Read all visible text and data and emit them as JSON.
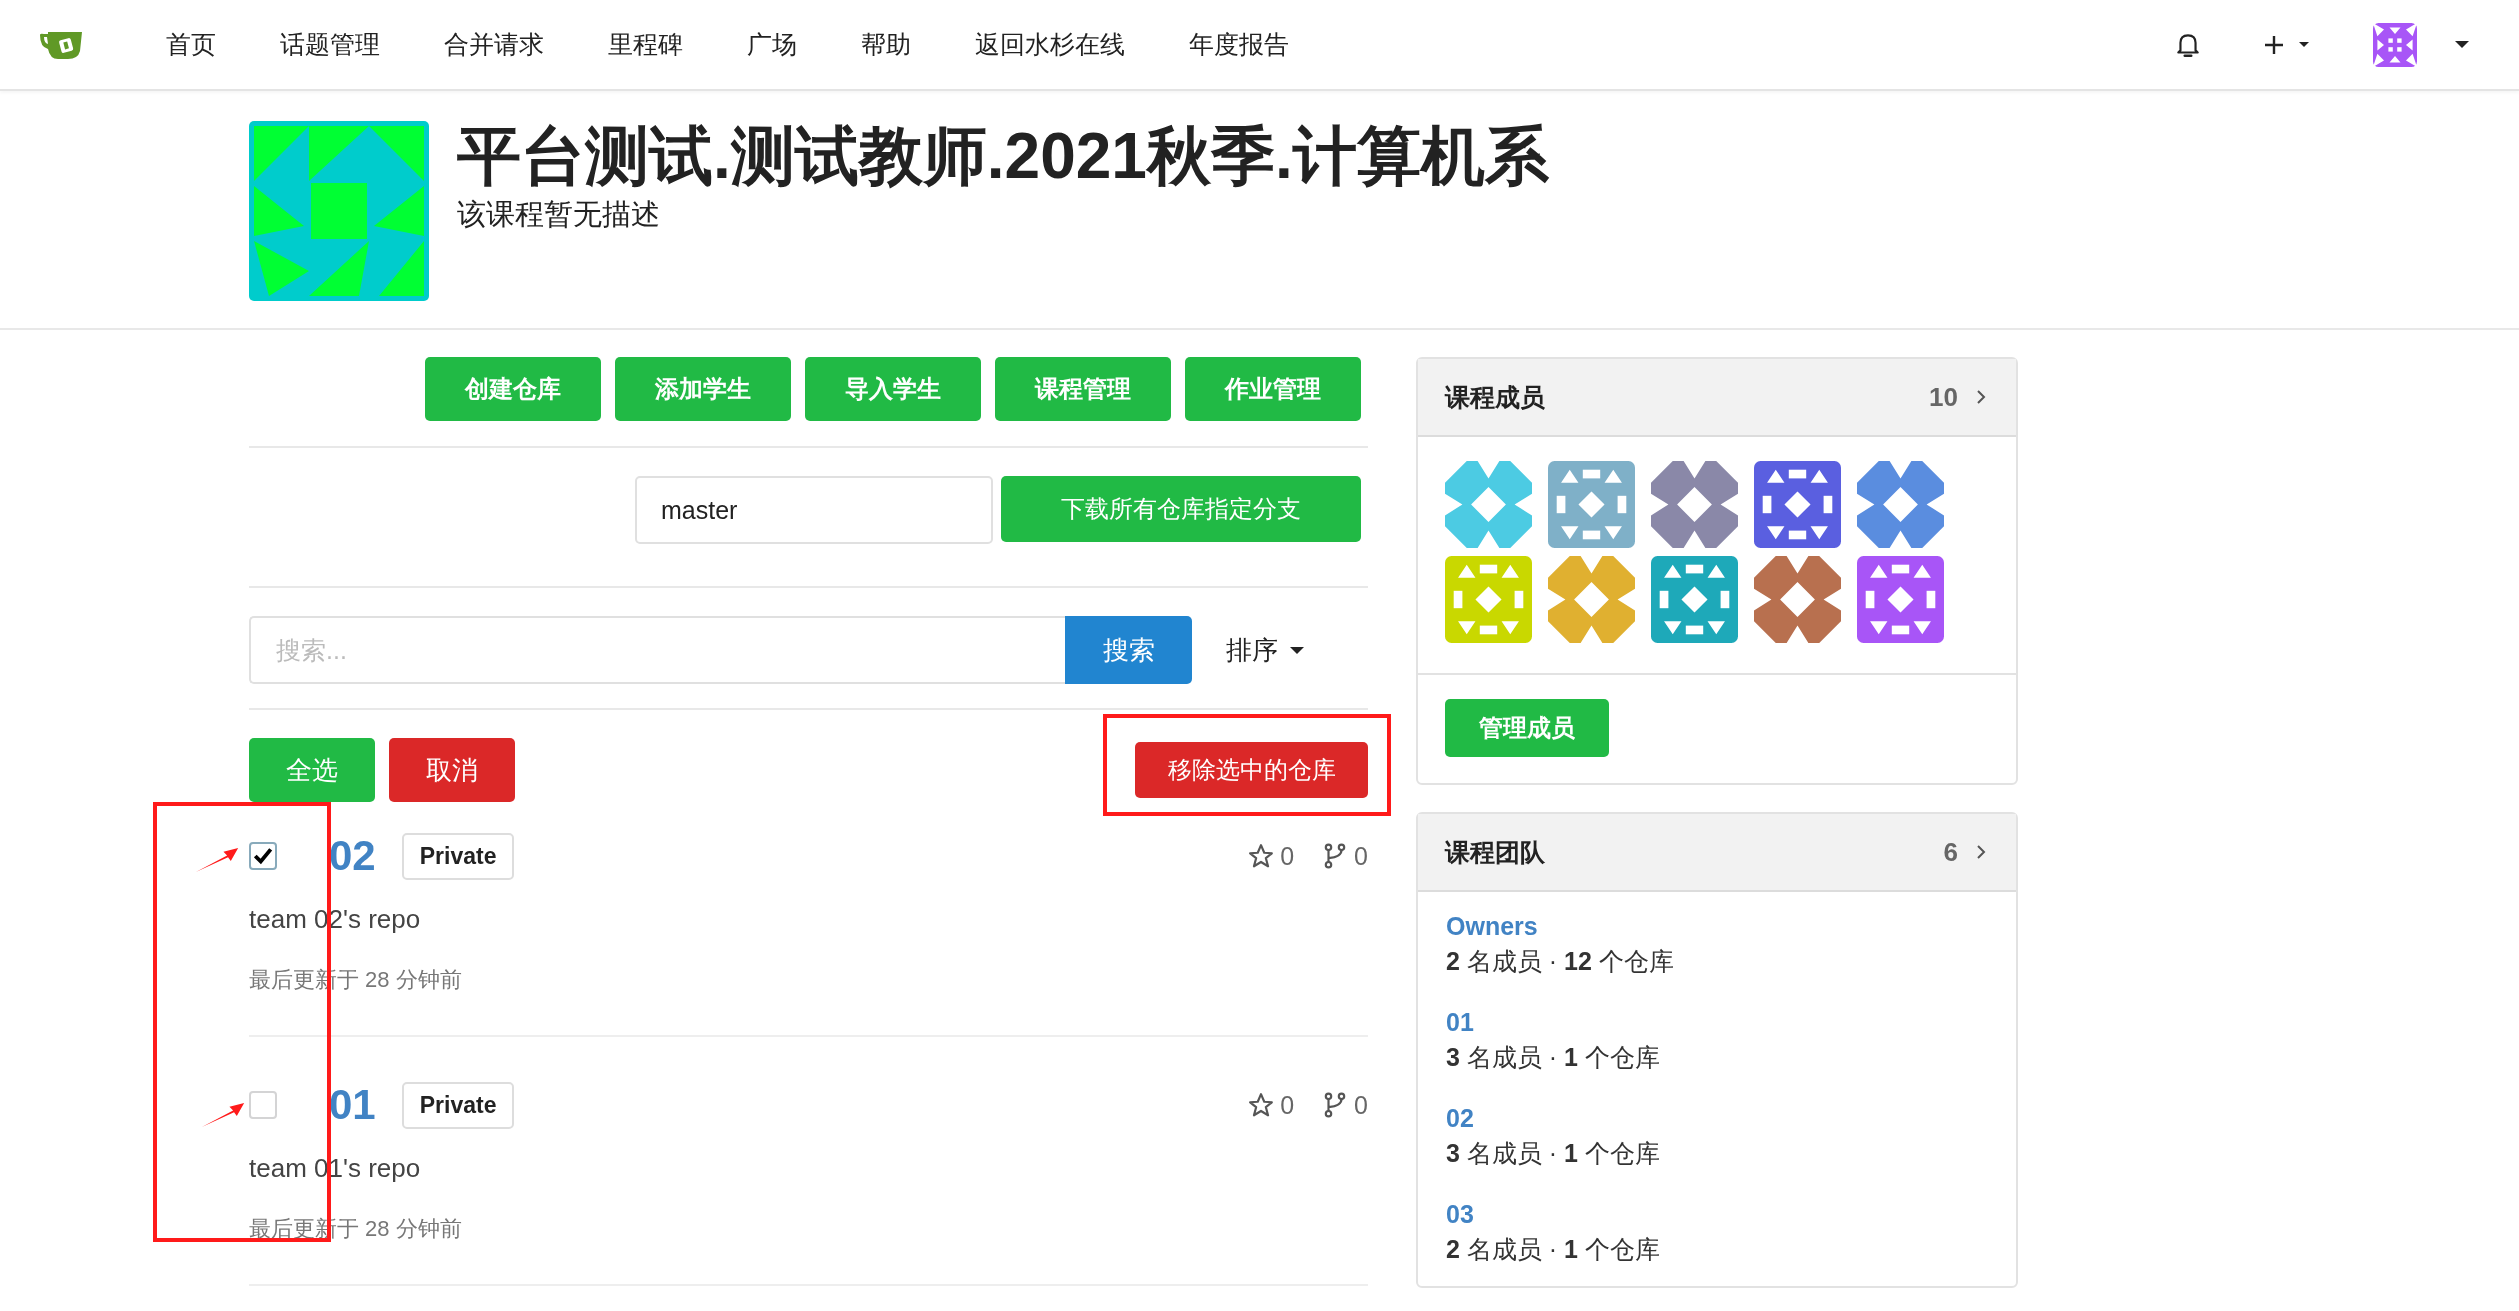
{
  "nav": {
    "items": [
      "首页",
      "话题管理",
      "合并请求",
      "里程碑",
      "广场",
      "帮助",
      "返回水杉在线",
      "年度报告"
    ]
  },
  "course": {
    "title": "平台测试.测试教师.2021秋季.计算机系",
    "description": "该课程暂无描述"
  },
  "actions": [
    "创建仓库",
    "添加学生",
    "导入学生",
    "课程管理",
    "作业管理"
  ],
  "branch": {
    "value": "master",
    "button": "下载所有仓库指定分支"
  },
  "search": {
    "placeholder": "搜索...",
    "button": "搜索",
    "sort": "排序"
  },
  "selection": {
    "select_all": "全选",
    "cancel": "取消",
    "remove": "移除选中的仓库"
  },
  "repos": [
    {
      "name": "02",
      "badge": "Private",
      "description": "team 02's repo",
      "updated": "最后更新于 28 分钟前",
      "stars": "0",
      "forks": "0",
      "checked": true
    },
    {
      "name": "01",
      "badge": "Private",
      "description": "team 01's repo",
      "updated": "最后更新于 28 分钟前",
      "stars": "0",
      "forks": "0",
      "checked": false
    }
  ],
  "members_card": {
    "title": "课程成员",
    "count": "10",
    "button": "管理成员",
    "members": [
      {
        "color": "#4ccbe3"
      },
      {
        "color": "#7fb0c8"
      },
      {
        "color": "#8a88a8"
      },
      {
        "color": "#5a5fe0"
      },
      {
        "color": "#5a8ddf"
      },
      {
        "color": "#c9d800"
      },
      {
        "color": "#e0b030"
      },
      {
        "color": "#1ea9b9"
      },
      {
        "color": "#b8704f"
      },
      {
        "color": "#a855f7"
      }
    ]
  },
  "teams_card": {
    "title": "课程团队",
    "count": "6",
    "teams": [
      {
        "name": "Owners",
        "stats": "**2** 名成员 · **12** 个仓库"
      },
      {
        "name": "01",
        "stats": "**3** 名成员 · **1** 个仓库"
      },
      {
        "name": "02",
        "stats": "**3** 名成员 · **1** 个仓库"
      },
      {
        "name": "03",
        "stats": "**2** 名成员 · **1** 个仓库"
      }
    ]
  }
}
